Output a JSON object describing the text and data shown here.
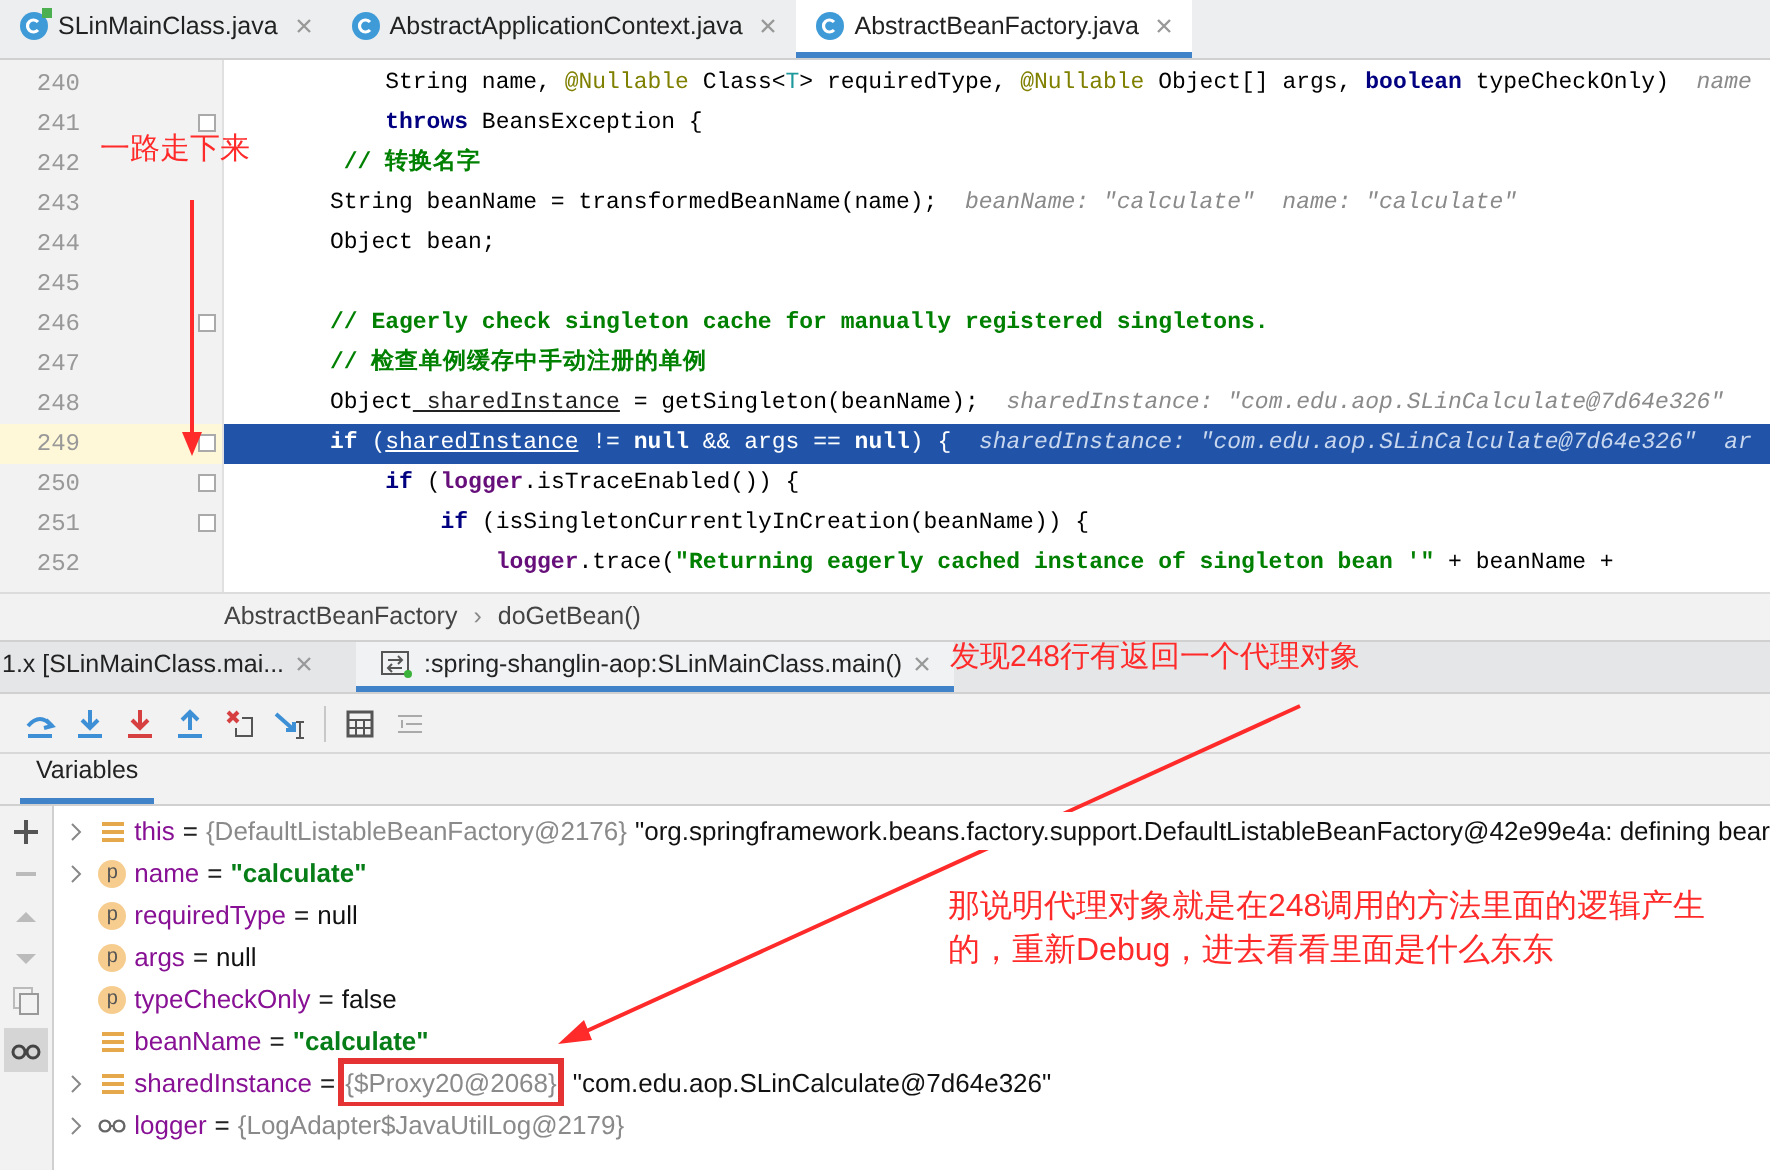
{
  "editor_tabs": [
    {
      "label": "SLinMainClass.java",
      "selected": false,
      "kind": "main"
    },
    {
      "label": "AbstractApplicationContext.java",
      "selected": false,
      "kind": "class"
    },
    {
      "label": "AbstractBeanFactory.java",
      "selected": true,
      "kind": "class"
    }
  ],
  "code_lines": [
    {
      "number": "240",
      "current": false,
      "fold": false,
      "segments": [
        {
          "t": "    String name,",
          "kind": "plain"
        },
        {
          "t": " @Nullable",
          "kind": "annotation"
        },
        {
          "t": " Class<",
          "kind": "plain"
        },
        {
          "t": "T",
          "kind": "type"
        },
        {
          "t": "> requiredType,",
          "kind": "plain"
        },
        {
          "t": " @Nullable",
          "kind": "annotation"
        },
        {
          "t": " Object[] args,",
          "kind": "plain"
        },
        {
          "t": " boolean",
          "kind": "keyword"
        },
        {
          "t": " typeCheckOnly)",
          "kind": "plain"
        },
        {
          "t": "  name",
          "kind": "hint"
        }
      ]
    },
    {
      "number": "241",
      "current": false,
      "fold": true,
      "segments": [
        {
          "t": "    throws",
          "kind": "keyword"
        },
        {
          "t": " BeansException {",
          "kind": "plain"
        }
      ]
    },
    {
      "number": "242",
      "current": false,
      "fold": false,
      "segments": [
        {
          "t": " // 转换名字",
          "kind": "comment"
        }
      ]
    },
    {
      "number": "243",
      "current": false,
      "fold": false,
      "segments": [
        {
          "t": "String beanName = transformedBeanName(name);",
          "kind": "plain"
        },
        {
          "t": "  beanName: \"calculate\"  name: \"calculate\"",
          "kind": "hint"
        }
      ]
    },
    {
      "number": "244",
      "current": false,
      "fold": false,
      "segments": [
        {
          "t": "Object bean;",
          "kind": "plain"
        }
      ]
    },
    {
      "number": "245",
      "current": false,
      "fold": false
    },
    {
      "number": "246",
      "current": false,
      "fold": true,
      "segments": [
        {
          "t": "// Eagerly check singleton cache for manually registered singletons.",
          "kind": "comment"
        }
      ]
    },
    {
      "number": "247",
      "current": false,
      "fold": false,
      "segments": [
        {
          "t": "// 检查单例缓存中手动注册的单例",
          "kind": "comment"
        }
      ]
    },
    {
      "number": "248",
      "current": false,
      "fold": false,
      "segments": [
        {
          "t": "Object",
          "kind": "plain"
        },
        {
          "t": " sharedInstance",
          "kind": "var"
        },
        {
          "t": " = getSingleton(beanName);",
          "kind": "plain"
        },
        {
          "t": "  sharedInstance: \"com.edu.aop.SLinCalculate@7d64e326\"",
          "kind": "hint"
        }
      ]
    },
    {
      "number": "249",
      "current": true,
      "fold": true,
      "segments": [
        {
          "t": "if",
          "kind": "keyword"
        },
        {
          "t": " (",
          "kind": "plain"
        },
        {
          "t": "sharedInstance",
          "kind": "var"
        },
        {
          "t": " !=",
          "kind": "plain"
        },
        {
          "t": " null",
          "kind": "keyword"
        },
        {
          "t": " && args ==",
          "kind": "plain"
        },
        {
          "t": " null",
          "kind": "keyword"
        },
        {
          "t": ") {",
          "kind": "plain"
        },
        {
          "t": "  sharedInstance: \"com.edu.aop.SLinCalculate@7d64e326\"  ar",
          "kind": "hint"
        }
      ]
    },
    {
      "number": "250",
      "current": false,
      "fold": true,
      "segments": [
        {
          "t": "    if",
          "kind": "keyword"
        },
        {
          "t": " (",
          "kind": "plain"
        },
        {
          "t": "logger",
          "kind": "field"
        },
        {
          "t": ".isTraceEnabled()) {",
          "kind": "plain"
        }
      ]
    },
    {
      "number": "251",
      "current": false,
      "fold": true,
      "segments": [
        {
          "t": "        if",
          "kind": "keyword"
        },
        {
          "t": " (isSingletonCurrentlyInCreation(beanName)) {",
          "kind": "plain"
        }
      ]
    },
    {
      "number": "252",
      "current": false,
      "fold": false,
      "segments": [
        {
          "t": "            logger",
          "kind": "field"
        },
        {
          "t": ".trace(",
          "kind": "plain"
        },
        {
          "t": "\"Returning eagerly cached instance of singleton bean '\"",
          "kind": "string"
        },
        {
          "t": " + beanName +",
          "kind": "plain"
        }
      ]
    }
  ],
  "breadcrumb": [
    "AbstractBeanFactory",
    "›",
    "doGetBean()"
  ],
  "debug_tabs": [
    {
      "label": "1.x [SLinMainClass.mai...",
      "selected": false
    },
    {
      "label": ":spring-shanglin-aop:SLinMainClass.main()",
      "selected": true
    }
  ],
  "variables_tab": {
    "label": "Variables",
    "selected": true
  },
  "variables": [
    {
      "kind": "field",
      "expandable": true,
      "name": "this",
      "sign": "=",
      "parts": [
        {
          "t": "{DefaultListableBeanFactory@2176}",
          "kind": "ref"
        },
        {
          "t": "\"org.springframework.beans.factory.support.DefaultListableBeanFactory@42e99e4a: defining bear",
          "kind": "plain"
        }
      ]
    },
    {
      "kind": "param",
      "badge": "p",
      "expandable": true,
      "name": "name",
      "sign": "=",
      "parts": [
        {
          "t": "\"calculate\"",
          "kind": "string"
        }
      ]
    },
    {
      "kind": "param",
      "badge": "p",
      "expandable": false,
      "name": "requiredType",
      "sign": "=",
      "parts": [
        {
          "t": "null",
          "kind": "plain"
        }
      ]
    },
    {
      "kind": "param",
      "badge": "p",
      "expandable": false,
      "name": "args",
      "sign": "=",
      "parts": [
        {
          "t": "null",
          "kind": "plain"
        }
      ]
    },
    {
      "kind": "param",
      "badge": "p",
      "expandable": false,
      "name": "typeCheckOnly",
      "sign": "=",
      "parts": [
        {
          "t": "false",
          "kind": "plain"
        }
      ]
    },
    {
      "kind": "field",
      "expandable": false,
      "name": "beanName",
      "sign": "=",
      "parts": [
        {
          "t": "\"calculate\"",
          "kind": "string"
        }
      ]
    },
    {
      "kind": "field",
      "expandable": true,
      "name": "sharedInstance",
      "sign": "=",
      "parts": [
        {
          "t": "{$Proxy20@2068}",
          "kind": "ref",
          "boxed": true
        },
        {
          "t": "\"com.edu.aop.SLinCalculate@7d64e326\"",
          "kind": "plain"
        }
      ]
    },
    {
      "kind": "watch",
      "expandable": true,
      "name": "logger",
      "sign": "=",
      "parts": [
        {
          "t": "{LogAdapter$JavaUtilLog@2179}",
          "kind": "ref"
        }
      ]
    }
  ],
  "annotations": [
    {
      "text": "一路走下来"
    },
    {
      "text": "发现248行有返回一个代理对象"
    },
    {
      "text": "那说明代理对象就是在248调用的方法里面的逻辑产生的，重新Debug，进去看看里面是什么东东"
    }
  ]
}
